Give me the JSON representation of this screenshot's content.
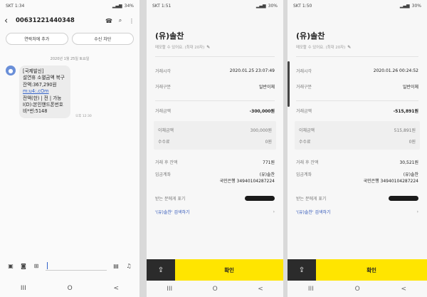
{
  "sms": {
    "status": {
      "carrier_time": "SKT 1:34",
      "right": "34%"
    },
    "header": {
      "number": "00631221440348",
      "call_icon": "phone-icon",
      "search_icon": "search-icon",
      "more_icon": "more-icon"
    },
    "buttons": {
      "add_contact": "연락처에 추가",
      "block": "수신 차단"
    },
    "date": "2020년 1월 25일 토요일",
    "message": {
      "lines": [
        "[국제발신]",
        "설연휴 소멸금액 복구",
        "잔액:367,290원"
      ],
      "link": "m:u4:.cOm",
      "lines2": [
        "전액(한) | 전 | 가능",
        "I(D):본인핸드폰번호",
        "비*번:5148"
      ],
      "time": "오후 12:30"
    },
    "navbar": {
      "recent": "III",
      "home": "O",
      "back": "<"
    }
  },
  "transfers": [
    {
      "status": {
        "carrier_time": "SKT 1:51",
        "right": "30%"
      },
      "title": "(유)솔찬",
      "memo": "메모할 수 있어요. (최대 20자)",
      "datetime_label": "거래시각",
      "datetime": "2020.01.25 23:07:49",
      "type_label": "거래구분",
      "type": "일반이체",
      "amount_label": "거래금액",
      "amount": "-300,000원",
      "transfer_label": "이체금액",
      "transfer_amount": "300,000원",
      "fee_label": "수수료",
      "fee": "0원",
      "balance_label": "거래 후 잔액",
      "balance": "771원",
      "account_label": "입금계좌",
      "account_name": "(유)솔찬",
      "account_number": "국민은행 34940104287224",
      "recipient_label": "받는 분에게 표기",
      "search_link": "'(유)솔찬' 검색하기",
      "confirm": "확인"
    },
    {
      "status": {
        "carrier_time": "SKT 1:50",
        "right": "30%"
      },
      "title": "(유)솔찬",
      "memo": "메모할 수 있어요. (최대 20자)",
      "datetime_label": "거래시각",
      "datetime": "2020.01.26 00:24:52",
      "type_label": "거래구분",
      "type": "일반이체",
      "amount_label": "거래금액",
      "amount": "-515,891원",
      "transfer_label": "이체금액",
      "transfer_amount": "515,891원",
      "fee_label": "수수료",
      "fee": "0원",
      "balance_label": "거래 후 잔액",
      "balance": "30,521원",
      "account_label": "입금계좌",
      "account_name": "(유)솔찬",
      "account_number": "국민은행 34940104287224",
      "recipient_label": "받는 분에게 표기",
      "search_link": "'(유)솔찬' 검색하기",
      "confirm": "확인"
    }
  ]
}
